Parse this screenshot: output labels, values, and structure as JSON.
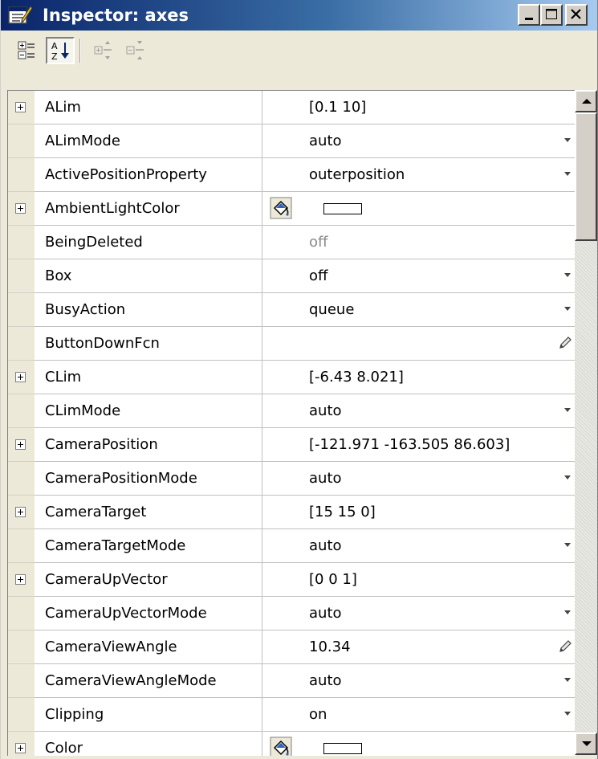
{
  "window": {
    "title": "Inspector: axes"
  },
  "colors": {
    "title_gradient_start": "#0a246a",
    "title_gradient_end": "#a6caf0",
    "chrome": "#ece9d8",
    "disabled_text": "#8a8a8a"
  },
  "toolbar": {
    "buttons": [
      {
        "name": "categorized-view-icon",
        "pressed": false
      },
      {
        "name": "alphabetical-sort-icon",
        "pressed": true
      },
      {
        "name": "expand-all-icon",
        "pressed": false,
        "disabled": true
      },
      {
        "name": "collapse-all-icon",
        "pressed": false,
        "disabled": true
      }
    ]
  },
  "properties": [
    {
      "name": "ALim",
      "value": "[0.1 10]",
      "expandable": true,
      "editor": "none"
    },
    {
      "name": "ALimMode",
      "value": "auto",
      "expandable": false,
      "editor": "dropdown"
    },
    {
      "name": "ActivePositionProperty",
      "value": "outerposition",
      "expandable": false,
      "editor": "dropdown"
    },
    {
      "name": "AmbientLightColor",
      "value": "",
      "expandable": true,
      "editor": "color"
    },
    {
      "name": "BeingDeleted",
      "value": "off",
      "expandable": false,
      "editor": "none",
      "disabled": true
    },
    {
      "name": "Box",
      "value": "off",
      "expandable": false,
      "editor": "dropdown"
    },
    {
      "name": "BusyAction",
      "value": "queue",
      "expandable": false,
      "editor": "dropdown"
    },
    {
      "name": "ButtonDownFcn",
      "value": "",
      "expandable": false,
      "editor": "pencil"
    },
    {
      "name": "CLim",
      "value": "[-6.43 8.021]",
      "expandable": true,
      "editor": "none"
    },
    {
      "name": "CLimMode",
      "value": "auto",
      "expandable": false,
      "editor": "dropdown"
    },
    {
      "name": "CameraPosition",
      "value": "[-121.971 -163.505 86.603]",
      "expandable": true,
      "editor": "none"
    },
    {
      "name": "CameraPositionMode",
      "value": "auto",
      "expandable": false,
      "editor": "dropdown"
    },
    {
      "name": "CameraTarget",
      "value": "[15 15 0]",
      "expandable": true,
      "editor": "none"
    },
    {
      "name": "CameraTargetMode",
      "value": "auto",
      "expandable": false,
      "editor": "dropdown"
    },
    {
      "name": "CameraUpVector",
      "value": "[0 0 1]",
      "expandable": true,
      "editor": "none"
    },
    {
      "name": "CameraUpVectorMode",
      "value": "auto",
      "expandable": false,
      "editor": "dropdown"
    },
    {
      "name": "CameraViewAngle",
      "value": "10.34",
      "expandable": false,
      "editor": "pencil"
    },
    {
      "name": "CameraViewAngleMode",
      "value": "auto",
      "expandable": false,
      "editor": "dropdown"
    },
    {
      "name": "Clipping",
      "value": "on",
      "expandable": false,
      "editor": "dropdown"
    },
    {
      "name": "Color",
      "value": "",
      "expandable": true,
      "editor": "color"
    }
  ],
  "scrollbar": {
    "position_fraction": 0.0
  }
}
